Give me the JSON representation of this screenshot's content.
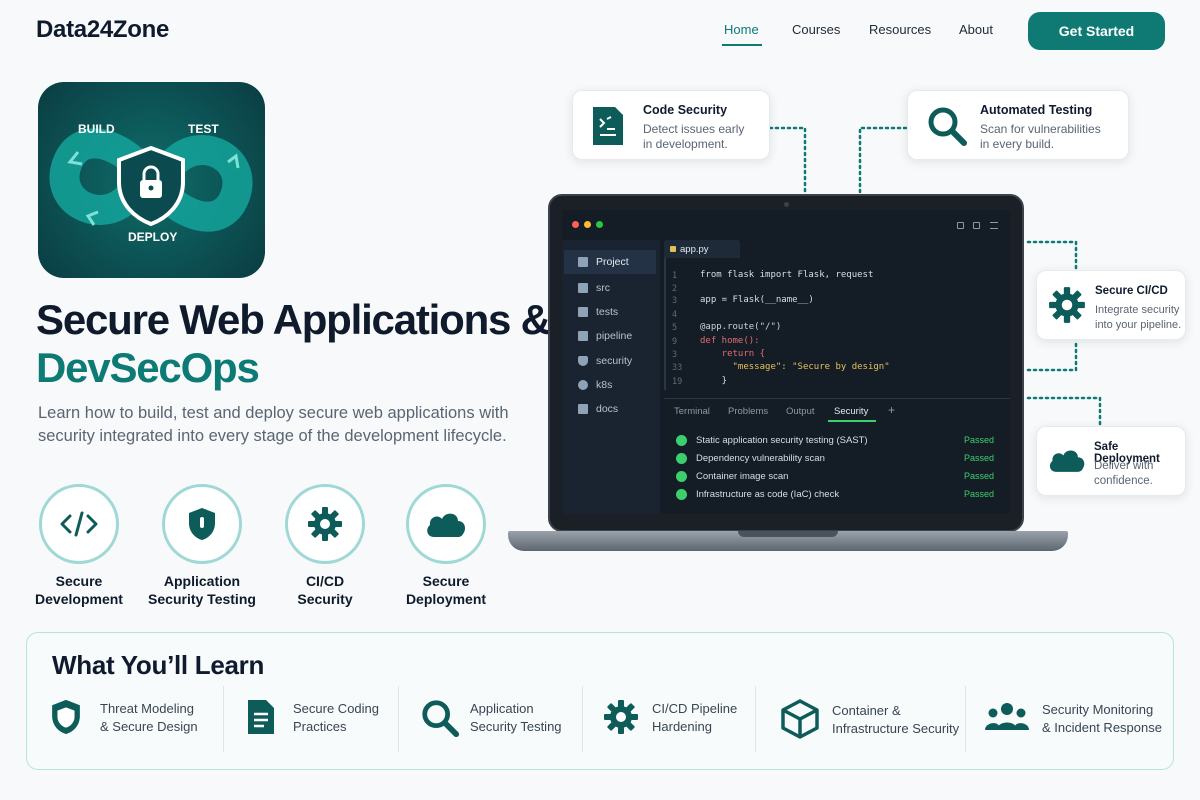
{
  "header": {
    "logo": "Data24Zone",
    "nav": [
      "Home",
      "Courses",
      "Resources",
      "About"
    ],
    "cta": "Get Started"
  },
  "app_icon": {
    "build": "BUILD",
    "test": "TEST",
    "deploy": "DEPLOY"
  },
  "hero": {
    "title_line1": "Secure Web Applications &",
    "title_line2": "DevSecOps",
    "lead": "Learn how to build, test and deploy secure web applications with security integrated into every stage of the development lifecycle."
  },
  "features": [
    {
      "line1": "Secure",
      "line2": "Development",
      "icon": "code-icon"
    },
    {
      "line1": "Application",
      "line2": "Security Testing",
      "icon": "shield-icon"
    },
    {
      "line1": "CI/CD",
      "line2": "Security",
      "icon": "gear-icon"
    },
    {
      "line1": "Secure",
      "line2": "Deployment",
      "icon": "cloud-icon"
    }
  ],
  "cards": {
    "code_security": {
      "title": "Code Security",
      "desc1": "Detect issues early",
      "desc2": "in development."
    },
    "automated_testing": {
      "title": "Automated Testing",
      "desc1": "Scan for vulnerabilities",
      "desc2": "in every build."
    },
    "secure_cicd": {
      "title": "Secure CI/CD",
      "desc1": "Integrate security",
      "desc2": "into your pipeline."
    },
    "safe_deployment": {
      "title": "Safe Deployment",
      "desc1": "Deliver with",
      "desc2": "confidence."
    }
  },
  "ide": {
    "sidebar": [
      "Project",
      "src",
      "tests",
      "pipeline",
      "security",
      "k8s",
      "docs"
    ],
    "file_tab": "app.py",
    "line_numbers": [
      "1",
      "2",
      "3",
      "4",
      "5",
      "9",
      "3",
      "33",
      "19"
    ],
    "code": [
      "from flask import Flask, request",
      "",
      "app = Flask(__name__)",
      "",
      "@app.route(\"/\")",
      "def home():",
      "    return {",
      "      \"message\": \"Secure by design\"",
      "    }"
    ],
    "panel_tabs": [
      "Terminal",
      "Problems",
      "Output",
      "Security",
      "+"
    ],
    "checks": [
      {
        "label": "Static application security testing (SAST)",
        "status": "Passed"
      },
      {
        "label": "Dependency vulnerability scan",
        "status": "Passed"
      },
      {
        "label": "Container image scan",
        "status": "Passed"
      },
      {
        "label": "Infrastructure as code (IaC) check",
        "status": "Passed"
      }
    ]
  },
  "learn": {
    "title": "What You’ll Learn",
    "items": [
      {
        "line1": "Threat Modeling",
        "line2": "& Secure Design",
        "icon": "shield-icon"
      },
      {
        "line1": "Secure Coding",
        "line2": "Practices",
        "icon": "document-icon"
      },
      {
        "line1": "Application",
        "line2": "Security Testing",
        "icon": "search-icon"
      },
      {
        "line1": "CI/CD Pipeline",
        "line2": "Hardening",
        "icon": "gear-icon"
      },
      {
        "line1": "Container &",
        "line2": "Infrastructure Security",
        "icon": "cube-icon"
      },
      {
        "line1": "Security Monitoring",
        "line2": "& Incident Response",
        "icon": "users-icon"
      }
    ]
  },
  "colors": {
    "brand": "#0f7a74",
    "dark": "#0f1b2d",
    "success": "#3ccf6e"
  }
}
